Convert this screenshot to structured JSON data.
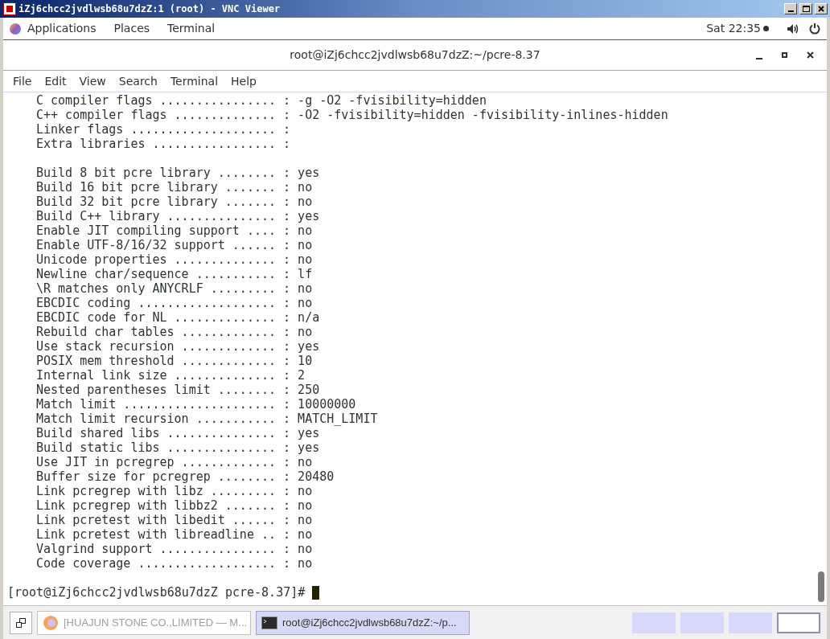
{
  "vnc_window": {
    "title": "iZj6chcc2jvdlwsb68u7dzZ:1 (root) - VNC Viewer"
  },
  "top_bar": {
    "menus": [
      "Applications",
      "Places",
      "Terminal"
    ],
    "clock": "Sat 22:35"
  },
  "terminal": {
    "title": "root@iZj6chcc2jvdlwsb68u7dzZ:~/pcre-8.37",
    "menu": [
      "File",
      "Edit",
      "View",
      "Search",
      "Terminal",
      "Help"
    ],
    "blocks": [
      [
        "C compiler flags ................ : -g -O2 -fvisibility=hidden",
        "C++ compiler flags .............. : -O2 -fvisibility=hidden -fvisibility-inlines-hidden",
        "Linker flags .................... :",
        "Extra libraries ................. :"
      ],
      [
        "Build 8 bit pcre library ........ : yes",
        "Build 16 bit pcre library ....... : no",
        "Build 32 bit pcre library ....... : no",
        "Build C++ library ............... : yes",
        "Enable JIT compiling support .... : no",
        "Enable UTF-8/16/32 support ...... : no",
        "Unicode properties .............. : no",
        "Newline char/sequence ........... : lf",
        "\\R matches only ANYCRLF ......... : no",
        "EBCDIC coding ................... : no",
        "EBCDIC code for NL .............. : n/a",
        "Rebuild char tables ............. : no",
        "Use stack recursion ............. : yes",
        "POSIX mem threshold ............. : 10",
        "Internal link size .............. : 2",
        "Nested parentheses limit ........ : 250",
        "Match limit ..................... : 10000000",
        "Match limit recursion ........... : MATCH_LIMIT",
        "Build shared libs ............... : yes",
        "Build static libs ............... : yes",
        "Use JIT in pcregrep ............. : no",
        "Buffer size for pcregrep ........ : 20480",
        "Link pcregrep with libz ......... : no",
        "Link pcregrep with libbz2 ....... : no",
        "Link pcretest with libedit ...... : no",
        "Link pcretest with libreadline .. : no",
        "Valgrind support ................ : no",
        "Code coverage ................... : no"
      ]
    ],
    "prompt": "[root@iZj6chcc2jvdlwsb68u7dzZ pcre-8.37]#"
  },
  "taskbar": {
    "items": [
      {
        "kind": "browser",
        "label": "[HUAJUN STONE CO.,LIMITED — M...",
        "selected": false
      },
      {
        "kind": "terminal",
        "label": "root@iZj6chcc2jvdlwsb68u7dzZ:~/p...",
        "selected": true
      }
    ],
    "workspaces": [
      {
        "selected": false
      },
      {
        "selected": false
      },
      {
        "selected": false
      },
      {
        "selected": true
      }
    ]
  }
}
